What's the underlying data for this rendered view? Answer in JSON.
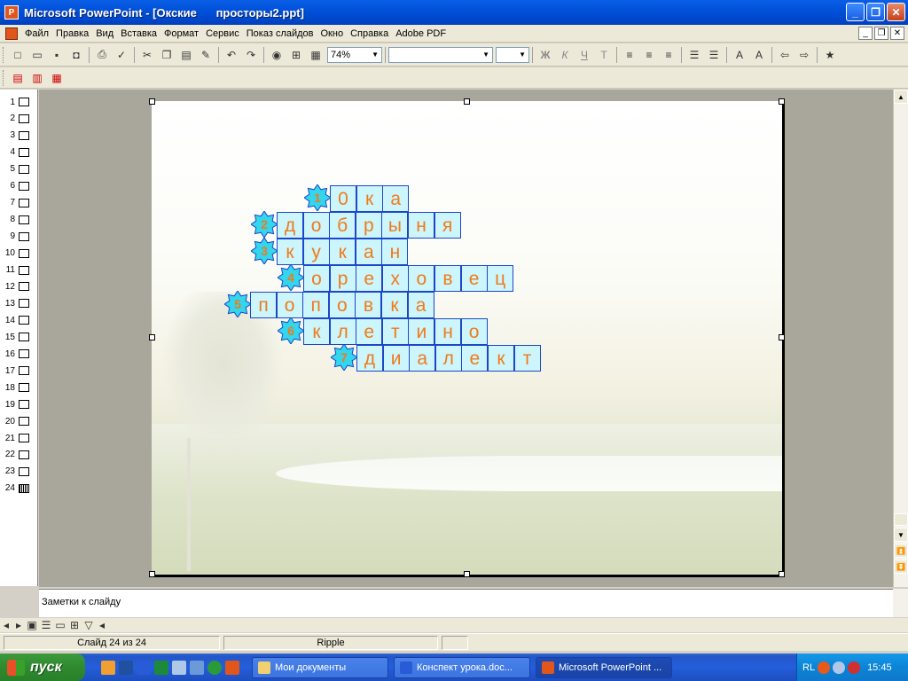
{
  "window": {
    "title": "Microsoft PowerPoint - [Окские      просторы2.ppt]",
    "app_icon": "P",
    "buttons": [
      "_",
      "❐",
      "✕"
    ]
  },
  "menu": {
    "items": [
      "Файл",
      "Правка",
      "Вид",
      "Вставка",
      "Формат",
      "Сервис",
      "Показ слайдов",
      "Окно",
      "Справка",
      "Adobe PDF"
    ],
    "doc_buttons": [
      "_",
      "❐",
      "✕"
    ]
  },
  "toolbar": {
    "zoom": "74%",
    "font_name": "",
    "font_size": "",
    "format_glyphs": [
      "Ж",
      "К",
      "Ч",
      "Т"
    ]
  },
  "slides": {
    "numbers": [
      "1",
      "2",
      "3",
      "4",
      "5",
      "6",
      "7",
      "8",
      "9",
      "10",
      "11",
      "12",
      "13",
      "14",
      "15",
      "16",
      "17",
      "18",
      "19",
      "20",
      "21",
      "22",
      "23",
      "24"
    ],
    "active": "24"
  },
  "crossword": {
    "rows": [
      {
        "number": "1",
        "letters": [
          "0",
          "к",
          "а"
        ]
      },
      {
        "number": "2",
        "letters": [
          "д",
          "о",
          "б",
          "р",
          "ы",
          "н",
          "я"
        ]
      },
      {
        "number": "3",
        "letters": [
          "к",
          "у",
          "к",
          "а",
          "н"
        ]
      },
      {
        "number": "4",
        "letters": [
          "о",
          "р",
          "е",
          "х",
          "о",
          "в",
          "е",
          "ц"
        ]
      },
      {
        "number": "5",
        "letters": [
          "п",
          "о",
          "п",
          "о",
          "в",
          "к",
          "а"
        ]
      },
      {
        "number": "6",
        "letters": [
          "к",
          "л",
          "е",
          "т",
          "и",
          "н",
          "о"
        ]
      },
      {
        "number": "7",
        "letters": [
          "д",
          "и",
          "а",
          "л",
          "е",
          "к",
          "т"
        ]
      }
    ],
    "colors": {
      "cell_bg": "#ccf6fc",
      "cell_border": "#1d46c8",
      "letter": "#f07a1a",
      "star": "#33d6ec"
    }
  },
  "notes": {
    "placeholder": "Заметки к слайду"
  },
  "status": {
    "slide": "Слайд 24 из 24",
    "design": "Ripple"
  },
  "taskbar": {
    "start": "пуск",
    "tasks": [
      "Мои документы",
      "Конспект урока.doc...",
      "Microsoft PowerPoint ..."
    ],
    "lang": "RL",
    "clock": "15:45"
  }
}
